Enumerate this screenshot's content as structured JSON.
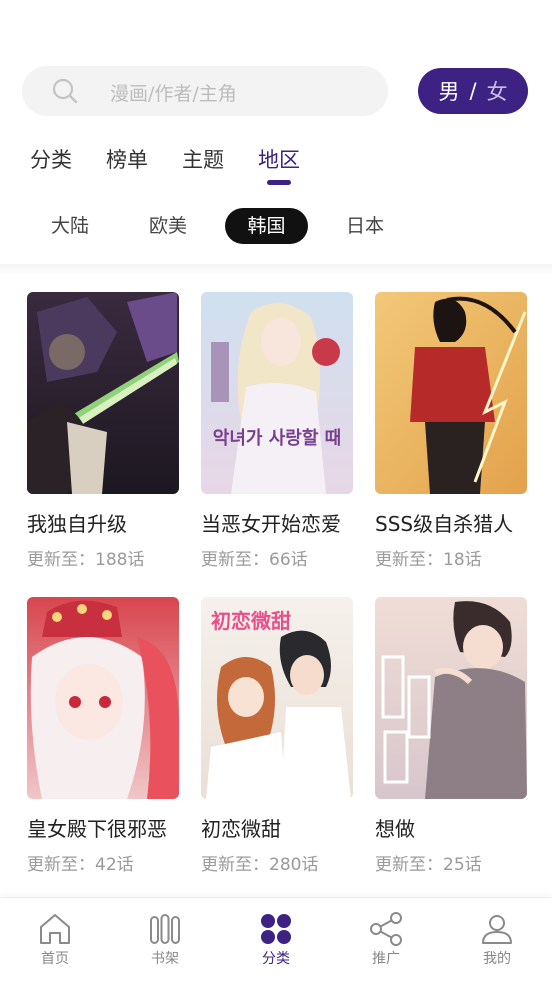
{
  "search": {
    "placeholder": "漫画/作者/主角"
  },
  "gender": {
    "male": "男",
    "separator": "/",
    "female": "女"
  },
  "tabs": [
    {
      "label": "分类",
      "active": false
    },
    {
      "label": "榜单",
      "active": false
    },
    {
      "label": "主题",
      "active": false
    },
    {
      "label": "地区",
      "active": true
    }
  ],
  "regions": [
    {
      "label": "大陆",
      "active": false
    },
    {
      "label": "欧美",
      "active": false
    },
    {
      "label": "韩国",
      "active": true
    },
    {
      "label": "日本",
      "active": false
    }
  ],
  "comics": [
    {
      "title": "我独自升级",
      "update": "更新至：188话"
    },
    {
      "title": "当恶女开始恋爱",
      "update": "更新至：66话",
      "cover_text": "악녀가 사랑할 때"
    },
    {
      "title": "SSS级自杀猎人",
      "update": "更新至：18话"
    },
    {
      "title": "皇女殿下很邪恶",
      "update": "更新至：42话"
    },
    {
      "title": "初恋微甜",
      "update": "更新至：280话",
      "cover_text": "初恋微甜"
    },
    {
      "title": "想做",
      "update": "更新至：25话"
    }
  ],
  "bottom_nav": [
    {
      "label": "首页",
      "icon": "home-icon",
      "active": false
    },
    {
      "label": "书架",
      "icon": "bookshelf-icon",
      "active": false
    },
    {
      "label": "分类",
      "icon": "category-icon",
      "active": true
    },
    {
      "label": "推广",
      "icon": "share-icon",
      "active": false
    },
    {
      "label": "我的",
      "icon": "profile-icon",
      "active": false
    }
  ],
  "colors": {
    "accent": "#3d2283",
    "active_pill": "#111111",
    "muted_text": "#9a9a9a"
  }
}
